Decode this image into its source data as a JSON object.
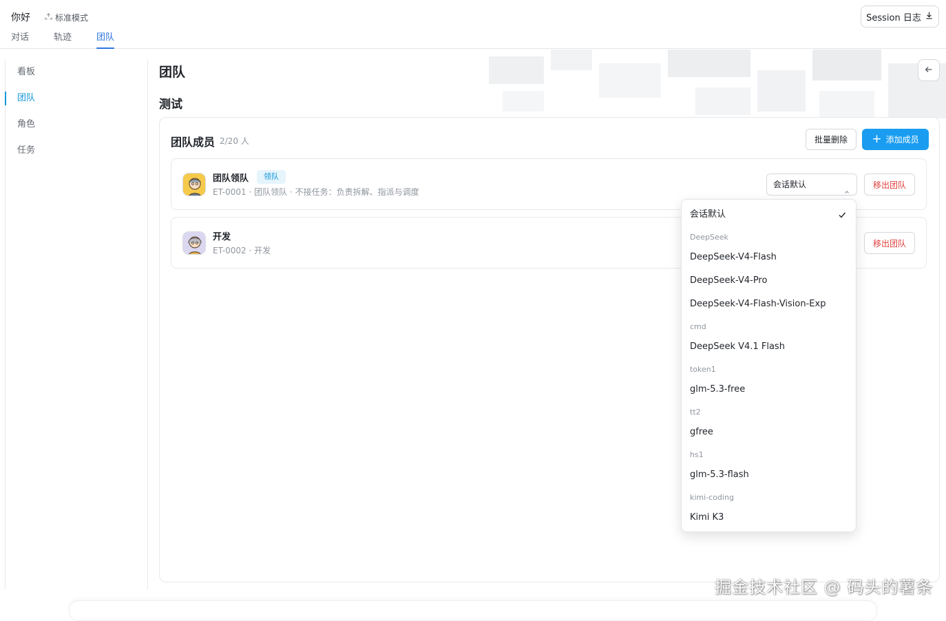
{
  "app": {
    "greeting": "你好",
    "mode_label": "标准模式",
    "session_log_label": "Session 日志"
  },
  "tabs": [
    {
      "label": "对话",
      "active": false
    },
    {
      "label": "轨迹",
      "active": false
    },
    {
      "label": "团队",
      "active": true
    }
  ],
  "sidebar": {
    "items": [
      {
        "label": "看板",
        "active": false
      },
      {
        "label": "团队",
        "active": true
      },
      {
        "label": "角色",
        "active": false
      },
      {
        "label": "任务",
        "active": false
      }
    ]
  },
  "page": {
    "title": "团队",
    "team_name": "测试"
  },
  "members_panel": {
    "title": "团队成员",
    "count": "2/20 人",
    "batch_delete_label": "批量删除",
    "add_member_label": "添加成员",
    "members": [
      {
        "name": "团队领队",
        "badge": "领队",
        "desc": "ET-0001 · 团队领队 · 不接任务：负责拆解、指派与调度",
        "model_select": "会话默认",
        "remove_label": "移出团队"
      },
      {
        "name": "开发",
        "badge": "",
        "desc": "ET-0002 · 开发",
        "model_select": "",
        "remove_label": "移出团队"
      }
    ]
  },
  "model_dropdown": {
    "selected": "会话默认",
    "groups": [
      {
        "label": "DeepSeek",
        "options": [
          "DeepSeek-V4-Flash",
          "DeepSeek-V4-Pro",
          "DeepSeek-V4-Flash-Vision-Exp"
        ]
      },
      {
        "label": "cmd",
        "options": [
          "DeepSeek V4.1 Flash"
        ]
      },
      {
        "label": "token1",
        "options": [
          "glm-5.3-free"
        ]
      },
      {
        "label": "tt2",
        "options": [
          "gfree"
        ]
      },
      {
        "label": "hs1",
        "options": [
          "glm-5.3-flash"
        ]
      },
      {
        "label": "kimi-coding",
        "options": [
          "Kimi K3"
        ]
      }
    ]
  },
  "watermark": "掘金技术社区 @ 码头的薯条",
  "colors": {
    "accent": "#1a9df0",
    "tab_active": "#2e74e0",
    "danger": "#e0403c"
  }
}
